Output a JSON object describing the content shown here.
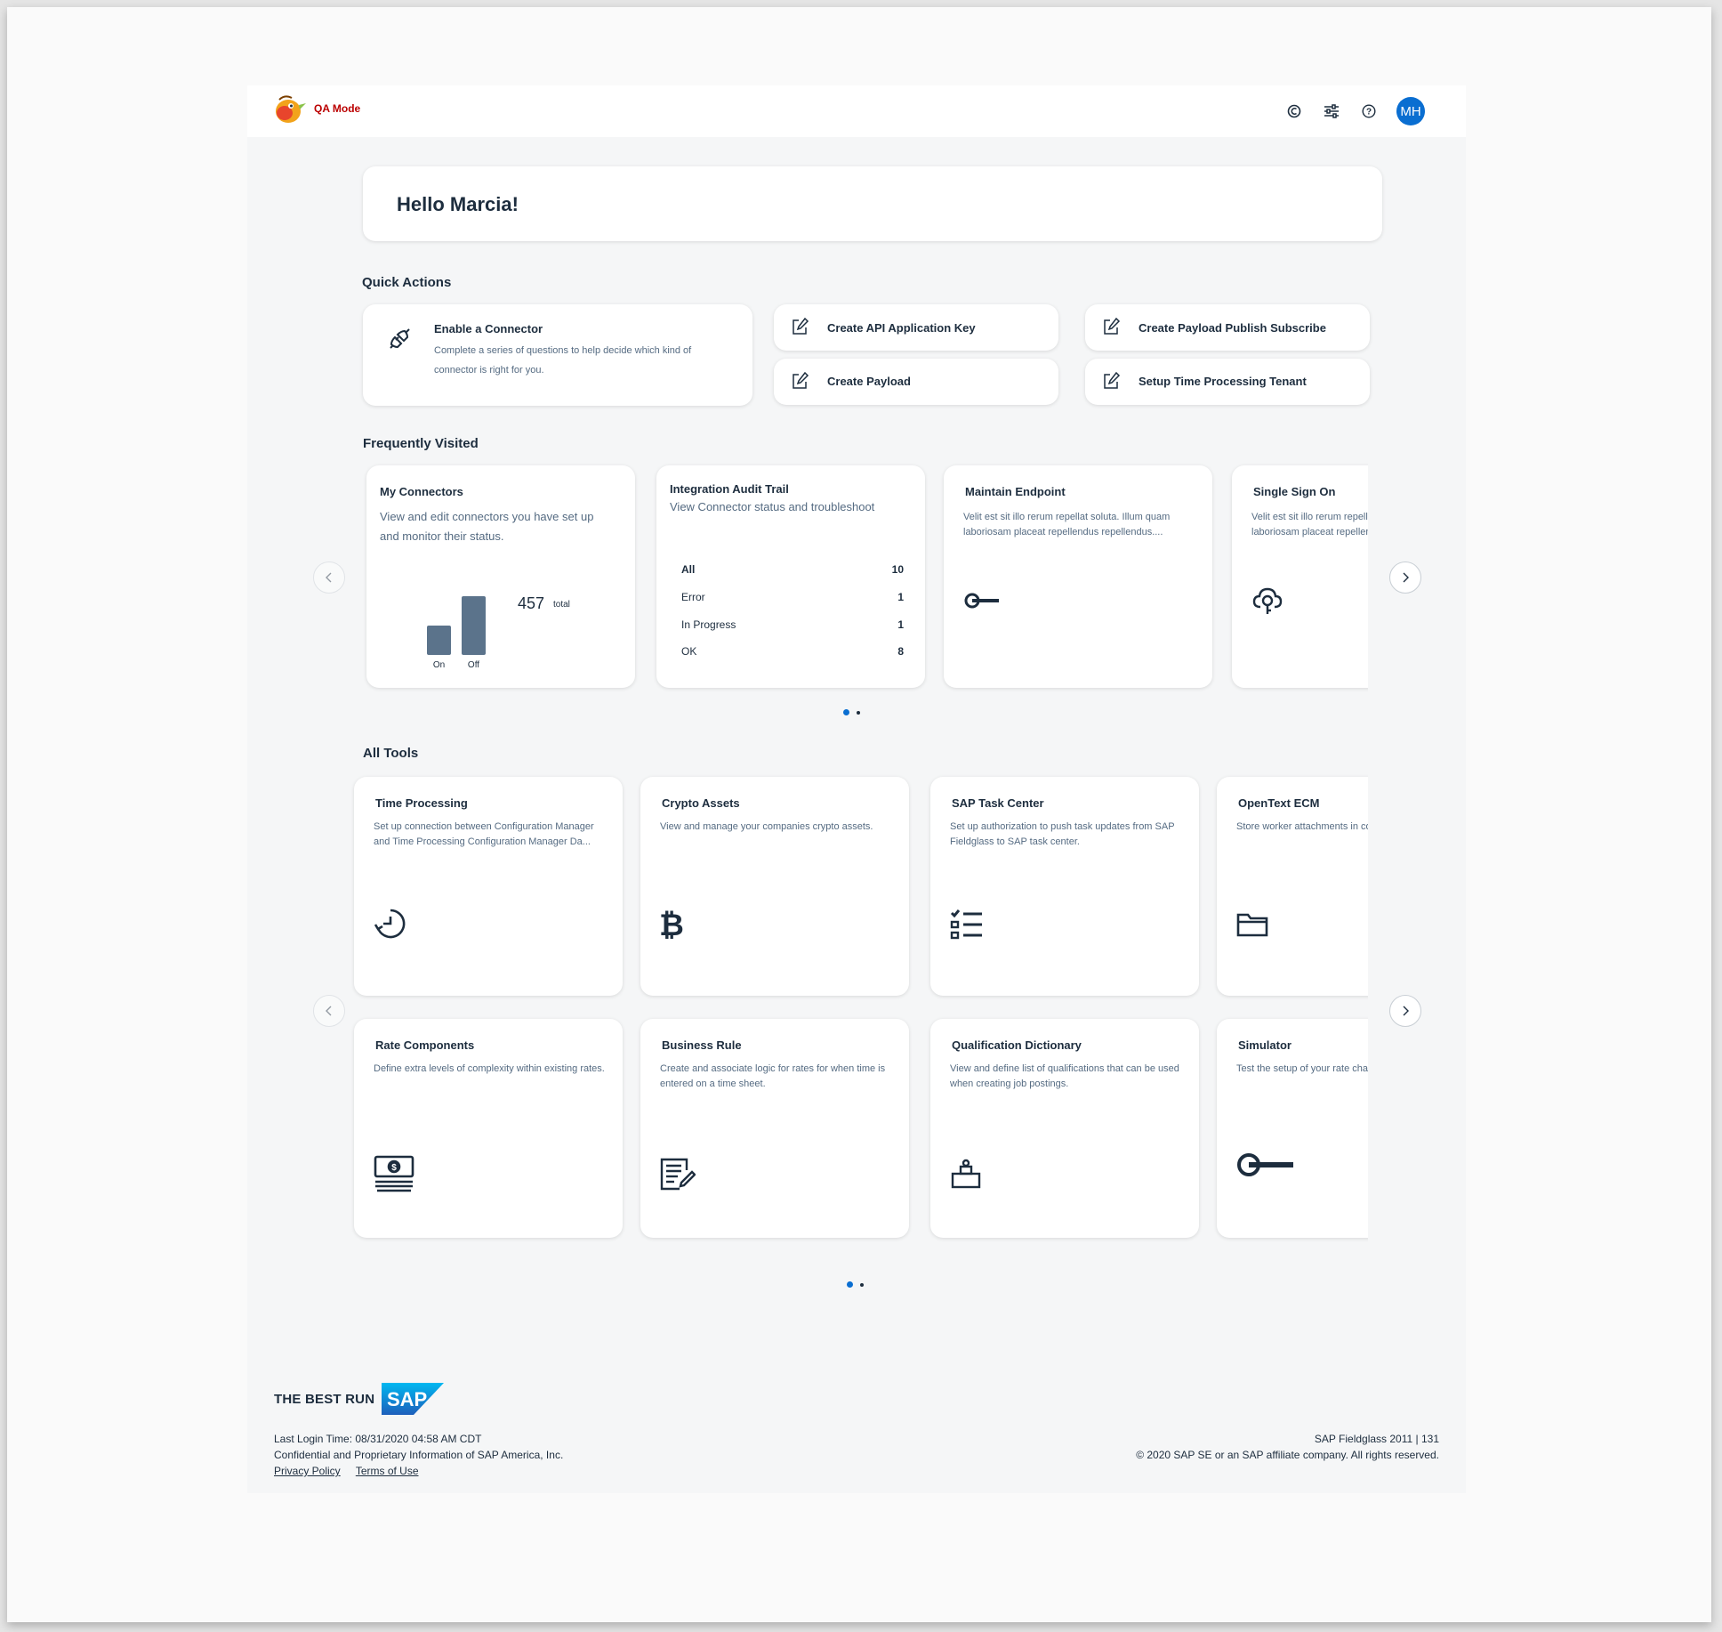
{
  "header": {
    "mode_label": "QA Mode",
    "avatar_initials": "MH",
    "icons": [
      "copilot-icon",
      "settings-icon",
      "help-icon"
    ]
  },
  "greeting": "Hello Marcia!",
  "quick_actions": {
    "title": "Quick Actions",
    "enable_connector": {
      "title": "Enable a Connector",
      "description_line1": "Complete a series of questions to help decide which kind of",
      "description_line2": "connector is right for you."
    },
    "items": [
      {
        "label": "Create API Application Key"
      },
      {
        "label": "Create Payload Publish Subscribe"
      },
      {
        "label": "Create Payload"
      },
      {
        "label": "Setup Time Processing Tenant"
      }
    ]
  },
  "frequently_visited": {
    "title": "Frequently Visited",
    "my_connectors": {
      "title": "My Connectors",
      "desc_line1": "View and edit connectors you have set up",
      "desc_line2": "and monitor their status.",
      "total_value": "457",
      "total_label": "total",
      "chart_data": {
        "type": "bar",
        "categories": [
          "On",
          "Off"
        ],
        "values": [
          0.5,
          1.0
        ],
        "title": "",
        "xlabel": "",
        "ylabel": ""
      }
    },
    "audit_trail": {
      "title": "Integration Audit Trail",
      "desc": "View Connector status and troubleshoot",
      "rows": [
        {
          "label": "All",
          "value": "10"
        },
        {
          "label": "Error",
          "value": "1"
        },
        {
          "label": "In Progress",
          "value": "1"
        },
        {
          "label": "OK",
          "value": "8"
        }
      ]
    },
    "maintain_endpoint": {
      "title": "Maintain Endpoint",
      "desc_line1": "Velit est sit illo rerum repellat soluta. Illum quam",
      "desc_line2": "laboriosam placeat repellendus repellendus...."
    },
    "single_sign_on": {
      "title": "Single Sign On",
      "desc_line1": "Velit est sit illo rerum repellat soluta. Illum quam",
      "desc_line2": "laboriosam placeat repellendus repellendus...."
    }
  },
  "all_tools": {
    "title": "All Tools",
    "tools": [
      {
        "title": "Time Processing",
        "desc": "Set up connection between Configuration Manager and Time Processing Configuration Manager Da...",
        "icon": "time-processing-icon"
      },
      {
        "title": "Crypto Assets",
        "desc": "View and manage your companies crypto assets.",
        "icon": "bitcoin-icon"
      },
      {
        "title": "SAP Task Center",
        "desc": "Set up authorization to push task updates from SAP Fieldglass to SAP task center.",
        "icon": "task-list-icon"
      },
      {
        "title": "OpenText ECM",
        "desc": "Store worker attachments in connection with the SAP Fieldglass System.",
        "icon": "folder-icon"
      },
      {
        "title": "Rate Components",
        "desc": "Define extra levels of complexity within existing rates.",
        "icon": "money-bills-icon"
      },
      {
        "title": "Business Rule",
        "desc": "Create and associate logic for rates for when time is entered on a time sheet.",
        "icon": "document-edit-icon"
      },
      {
        "title": "Qualification Dictionary",
        "desc": "View and define list of qualifications that can be used when creating job postings.",
        "icon": "qualification-icon"
      },
      {
        "title": "Simulator",
        "desc": "Test the setup of your rate chart before applying it.",
        "icon": "key-icon"
      }
    ]
  },
  "footer": {
    "brand_text": "THE BEST RUN",
    "brand_logo": "SAP",
    "last_login": "Last Login Time: 08/31/2020 04:58 AM CDT",
    "confidential": "Confidential and Proprietary Information of SAP America, Inc.",
    "privacy": "Privacy Policy",
    "terms": "Terms of Use",
    "version": "SAP Fieldglass 2011 | 131",
    "copyright": "© 2020 SAP SE or an SAP affiliate company. All rights reserved."
  },
  "colors": {
    "accent": "#0a6ed1",
    "bar": "#5b738b",
    "text": "#1d2d3e",
    "subtext": "#556b82"
  }
}
